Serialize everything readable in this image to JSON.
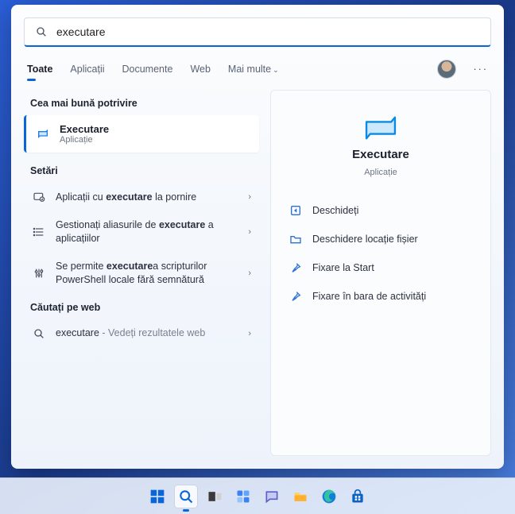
{
  "search": {
    "query": "executare"
  },
  "tabs": {
    "all": "Toate",
    "apps": "Aplicații",
    "docs": "Documente",
    "web": "Web",
    "more": "Mai multe"
  },
  "sections": {
    "best_match": "Cea mai bună potrivire",
    "settings": "Setări",
    "web_search": "Căutați pe web"
  },
  "best_match": {
    "title": "Executare",
    "subtitle": "Aplicație"
  },
  "settings_items": [
    {
      "pre": "Aplicații cu ",
      "bold": "executare",
      "post": " la pornire"
    },
    {
      "pre": "Gestionați aliasurile de ",
      "bold": "executare",
      "post": " a aplicațiilor"
    },
    {
      "pre": "Se permite ",
      "bold": "executare",
      "post": "a scripturilor PowerShell locale fără semnătură"
    }
  ],
  "web_item": {
    "term": "executare",
    "suffix": " - Vedeți rezultatele web"
  },
  "hero": {
    "title": "Executare",
    "subtitle": "Aplicație"
  },
  "actions": {
    "open": "Deschideți",
    "open_location": "Deschidere locație fișier",
    "pin_start": "Fixare la Start",
    "pin_taskbar": "Fixare în bara de activități"
  }
}
